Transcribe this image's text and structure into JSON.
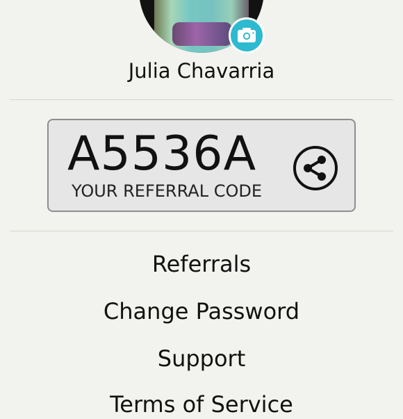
{
  "profile": {
    "name": "Julia Chavarria",
    "avatar_icon": "camera-icon",
    "camera_badge_color": "#2dbad0"
  },
  "referral": {
    "code": "A5536A",
    "caption": "YOUR REFERRAL CODE",
    "share_icon": "share-icon"
  },
  "menu": {
    "items": [
      {
        "label": "Referrals"
      },
      {
        "label": "Change Password"
      },
      {
        "label": "Support"
      },
      {
        "label": "Terms of Service"
      }
    ]
  }
}
